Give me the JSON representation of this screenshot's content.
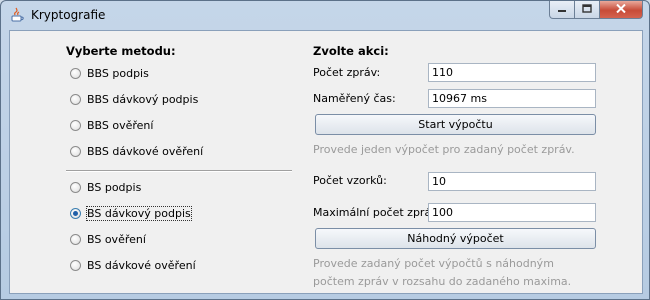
{
  "window": {
    "title": "Kryptografie"
  },
  "method_panel": {
    "heading": "Vyberte metodu:",
    "group1": [
      {
        "label": "BBS podpis",
        "checked": false
      },
      {
        "label": "BBS dávkový podpis",
        "checked": false
      },
      {
        "label": "BBS ověření",
        "checked": false
      },
      {
        "label": "BBS dávkové ověření",
        "checked": false
      }
    ],
    "group2": [
      {
        "label": "BS podpis",
        "checked": false
      },
      {
        "label": "BS dávkový podpis",
        "checked": true
      },
      {
        "label": "BS ověření",
        "checked": false
      },
      {
        "label": "BS dávkové ověření",
        "checked": false
      }
    ]
  },
  "action_panel": {
    "heading": "Zvolte akci:",
    "message_count": {
      "label": "Počet zpráv:",
      "value": "110"
    },
    "measured_time": {
      "label": "Naměřený čas:",
      "value": "10967 ms"
    },
    "start_button": "Start výpočtu",
    "start_hint": "Provede jeden výpočet pro zadaný počet zpráv.",
    "sample_count": {
      "label": "Počet vzorků:",
      "value": "10"
    },
    "max_messages": {
      "label": "Maximální počet zpráv:",
      "value": "100"
    },
    "random_button": "Náhodný výpočet",
    "random_hint_line1": "Provede zadaný počet výpočtů s náhodným",
    "random_hint_line2": "počtem zpráv v rozsahu do zadaného maxima."
  }
}
